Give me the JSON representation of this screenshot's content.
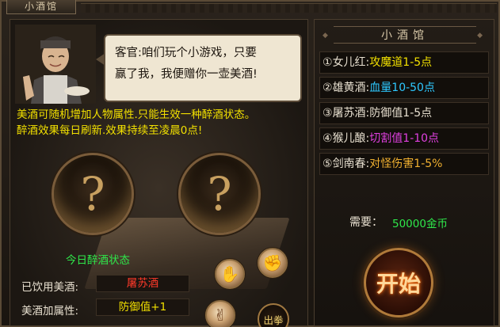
{
  "window": {
    "title": "小酒馆"
  },
  "npc": {
    "speech_line1": "客官:咱们玩个小游戏，只要",
    "speech_line2": "赢了我，我便赠你一壶美酒!"
  },
  "info": {
    "line1": "美酒可随机增加人物属性.只能生效一种醉酒状态。",
    "line2": "醉酒效果每日刷新.效果持续至凌晨0点!"
  },
  "slots": {
    "left_symbol": "?",
    "right_symbol": "?"
  },
  "today_status": {
    "label": "今日醉酒状态",
    "drunk_label": "已饮用美酒:",
    "drunk_value": "屠苏酒",
    "drunk_color": "#ff3a2a",
    "attr_label": "美酒加属性:",
    "attr_value": "防御值+1",
    "attr_color": "#f2e000"
  },
  "hands": {
    "paper_icon": "palm-hand-icon",
    "rock_icon": "fist-hand-icon",
    "scissors_icon": "two-finger-hand-icon",
    "play_label": "出拳"
  },
  "shop": {
    "title": "小酒馆",
    "wines": [
      {
        "index": "①",
        "name": "女儿红:",
        "effect": "攻魔道1-5点",
        "color": "#f2e000"
      },
      {
        "index": "②",
        "name": "雄黄酒:",
        "effect": "血量10-50点",
        "color": "#2ec8ff"
      },
      {
        "index": "③",
        "name": "屠苏酒:",
        "effect": "防御值1-5点",
        "color": "#e8e0d0"
      },
      {
        "index": "④",
        "name": "猴儿酿:",
        "effect": "切割值1-10点",
        "color": "#e040e0"
      },
      {
        "index": "⑤",
        "name": "剑南春:",
        "effect": "对怪伤害1-5%",
        "color": "#f0b030"
      }
    ],
    "need_label": "需要：",
    "need_value": "50000金币",
    "start_label": "开始"
  }
}
